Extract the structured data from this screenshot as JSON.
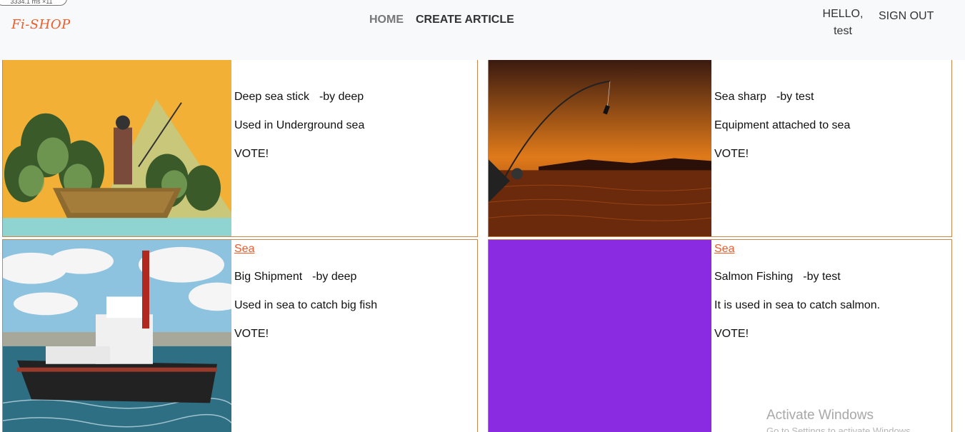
{
  "debug": {
    "text": "3334.1 ms  ×11"
  },
  "brand": {
    "logo": "Fi-SHOP",
    "accent": "#f05a28"
  },
  "nav": {
    "home": "HOME",
    "create": "CREATE ARTICLE",
    "hello": "HELLO,",
    "user": "test",
    "signout": "SIGN OUT"
  },
  "cards": [
    {
      "category": "",
      "title": "Deep sea stick",
      "author": "-by deep",
      "description": "Used in Underground sea",
      "vote": "VOTE!",
      "image": "cartoon-fisherman-boat"
    },
    {
      "category": "",
      "title": "Sea sharp",
      "author": "-by test",
      "description": "Equipment attached to sea",
      "vote": "VOTE!",
      "image": "fishing-rod-sunset"
    },
    {
      "category": "Sea",
      "title": "Big Shipment",
      "author": "-by deep",
      "description": "Used in sea to catch big fish",
      "vote": "VOTE!",
      "image": "tugboat-painting"
    },
    {
      "category": "Sea",
      "title": "Salmon Fishing",
      "author": "-by test",
      "description": "It is used in sea to catch salmon.",
      "vote": "VOTE!",
      "image": "purple-placeholder",
      "image_color": "#8a2be2"
    }
  ],
  "watermark": {
    "title": "Activate Windows",
    "subtitle": "Go to Settings to activate Windows."
  }
}
